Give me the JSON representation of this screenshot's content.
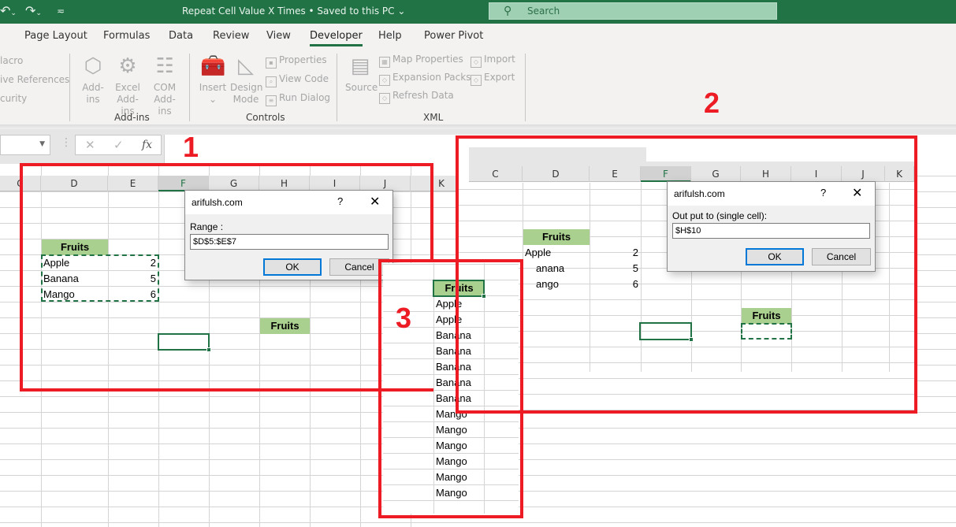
{
  "titlebar": {
    "undo_icon": "undo-icon",
    "redo_icon": "redo-icon",
    "customize_icon": "customize-qat-icon",
    "document_title": "Repeat Cell Value X Times • Saved to this PC ⌄",
    "search_placeholder": "Search",
    "search_icon": "search-icon"
  },
  "ribbon_tabs": [
    "Page Layout",
    "Formulas",
    "Data",
    "Review",
    "View",
    "Developer",
    "Help",
    "Power Pivot"
  ],
  "active_tab": "Developer",
  "ribbon": {
    "code_group_items": [
      "lacro",
      "ive References",
      "curity"
    ],
    "addins_group": {
      "label": "Add-ins",
      "buttons": [
        {
          "line1": "Add-",
          "line2": "ins"
        },
        {
          "line1": "Excel",
          "line2": "Add-ins"
        },
        {
          "line1": "COM",
          "line2": "Add-ins"
        }
      ]
    },
    "controls_group": {
      "label": "Controls",
      "insert": {
        "line1": "Insert",
        "line2": "⌄"
      },
      "design_mode": {
        "line1": "Design",
        "line2": "Mode"
      },
      "small_buttons": [
        "Properties",
        "View Code",
        "Run Dialog"
      ]
    },
    "xml_group": {
      "label": "XML",
      "source": "Source",
      "col1": [
        "Map Properties",
        "Expansion Packs",
        "Refresh Data"
      ],
      "col2": [
        "Import",
        "Export"
      ]
    }
  },
  "formula_bar": {
    "name_box": "",
    "cancel_icon": "✕",
    "enter_icon": "✓",
    "fx_label": "fx",
    "formula": ""
  },
  "sheet": {
    "columns": [
      "C",
      "D",
      "E",
      "F",
      "G",
      "H",
      "I",
      "J",
      "K"
    ],
    "selected_column": "F"
  },
  "panel1": {
    "number": "1",
    "header": "Fruits",
    "rows": [
      {
        "fruit": "Apple",
        "count": "2"
      },
      {
        "fruit": "Banana",
        "count": "5"
      },
      {
        "fruit": "Mango",
        "count": "6"
      }
    ],
    "output_header": "Fruits",
    "dialog": {
      "title": "arifulsh.com",
      "help": "?",
      "close": "✕",
      "label": "Range :",
      "value": "$D$5:$E$7",
      "ok": "OK",
      "cancel": "Cancel"
    }
  },
  "panel2": {
    "number": "2",
    "header": "Fruits",
    "rows": [
      {
        "fruit": "Apple",
        "count": "2"
      },
      {
        "fruit": "anana",
        "count": "5"
      },
      {
        "fruit": "ango",
        "count": "6"
      }
    ],
    "output_header": "Fruits",
    "dialog": {
      "title": "arifulsh.com",
      "help": "?",
      "close": "✕",
      "label": "Out put to (single cell):",
      "value": "$H$10",
      "ok": "OK",
      "cancel": "Cancel"
    }
  },
  "panel3": {
    "number": "3",
    "header": "Fruits",
    "results": [
      "Apple",
      "Apple",
      "Banana",
      "Banana",
      "Banana",
      "Banana",
      "Banana",
      "Mango",
      "Mango",
      "Mango",
      "Mango",
      "Mango",
      "Mango"
    ]
  },
  "colors": {
    "excel_green": "#217346",
    "header_fill": "#a9d08e",
    "annotation_red": "#ed1c24",
    "dialog_focus": "#0078d7"
  }
}
